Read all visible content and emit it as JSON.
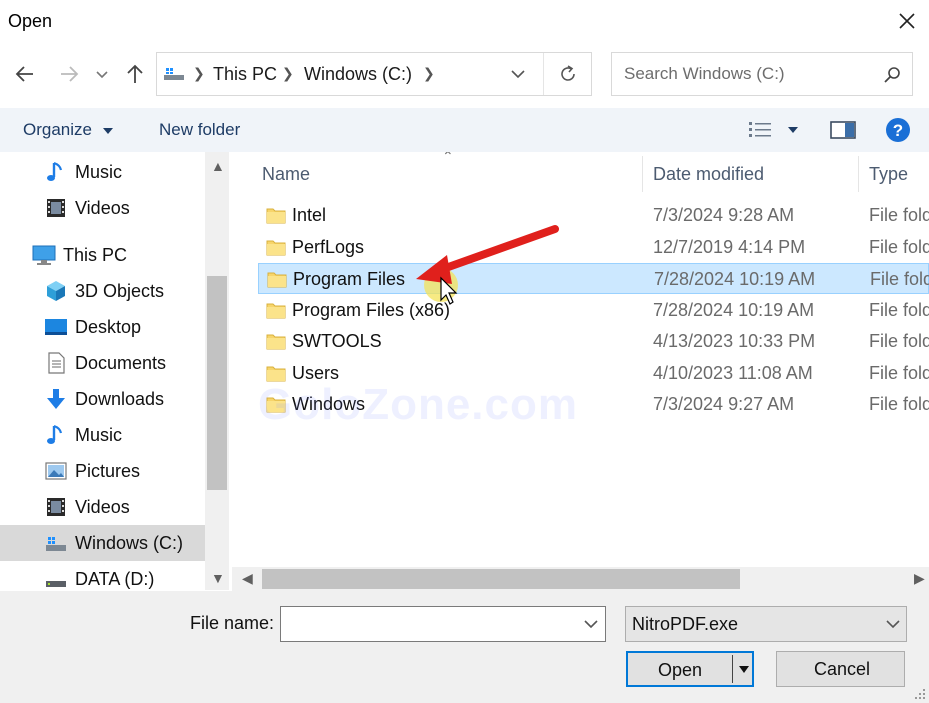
{
  "window": {
    "title": "Open"
  },
  "address": {
    "crumbs": [
      "This PC",
      "Windows (C:)"
    ]
  },
  "search": {
    "placeholder": "Search Windows (C:)"
  },
  "toolbar": {
    "organize": "Organize",
    "new_folder": "New folder"
  },
  "nav": {
    "items": [
      {
        "label": "Music",
        "icon": "music-icon"
      },
      {
        "label": "Videos",
        "icon": "videos-icon"
      },
      {
        "label": "This PC",
        "icon": "computer-icon"
      },
      {
        "label": "3D Objects",
        "icon": "3d-objects-icon"
      },
      {
        "label": "Desktop",
        "icon": "desktop-icon"
      },
      {
        "label": "Documents",
        "icon": "documents-icon"
      },
      {
        "label": "Downloads",
        "icon": "downloads-icon"
      },
      {
        "label": "Music",
        "icon": "music-icon"
      },
      {
        "label": "Pictures",
        "icon": "pictures-icon"
      },
      {
        "label": "Videos",
        "icon": "videos-icon"
      },
      {
        "label": "Windows (C:)",
        "icon": "drive-icon",
        "selected": true
      },
      {
        "label": "DATA (D:)",
        "icon": "drive-icon"
      }
    ]
  },
  "list": {
    "columns": {
      "name": "Name",
      "date": "Date modified",
      "type": "Type"
    },
    "rows": [
      {
        "name": "Intel",
        "date": "7/3/2024 9:28 AM",
        "type": "File fold"
      },
      {
        "name": "PerfLogs",
        "date": "12/7/2019 4:14 PM",
        "type": "File fold"
      },
      {
        "name": "Program Files",
        "date": "7/28/2024 10:19 AM",
        "type": "File fold",
        "selected": true
      },
      {
        "name": "Program Files (x86)",
        "date": "7/28/2024 10:19 AM",
        "type": "File fold"
      },
      {
        "name": "SWTOOLS",
        "date": "4/13/2023 10:33 PM",
        "type": "File fold"
      },
      {
        "name": "Users",
        "date": "4/10/2023 11:08 AM",
        "type": "File fold"
      },
      {
        "name": "Windows",
        "date": "7/3/2024 9:27 AM",
        "type": "File fold"
      }
    ]
  },
  "watermark": "GoloZone.com",
  "footer": {
    "file_name_label": "File name:",
    "file_name_value": "",
    "filter": "NitroPDF.exe",
    "open": "Open",
    "cancel": "Cancel"
  },
  "colors": {
    "selection": "#cce8ff",
    "toolbar_bg": "#f0f4f9",
    "accent": "#0078d7",
    "arrow": "#e0201c",
    "folder": "#f7d56b"
  }
}
